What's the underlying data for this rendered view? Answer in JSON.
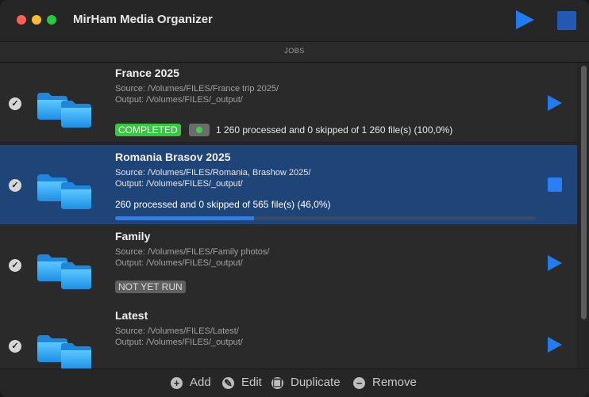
{
  "app": {
    "title": "MirHam Media Organizer"
  },
  "toolbar": {
    "play_icon": "play-icon",
    "stop_icon": "stop-icon"
  },
  "section": {
    "label": "JOBS"
  },
  "jobs": [
    {
      "name": "France 2025",
      "source": "Source: /Volumes/FILES/France trip 2025/",
      "output": "Output: /Volumes/FILES/_output/",
      "status": "COMPLETED",
      "progress_text": "1 260 processed and 0 skipped of 1 260 file(s) (100,0%)"
    },
    {
      "name": "Romania Brasov 2025",
      "source": "Source: /Volumes/FILES/Romania, Brashow 2025/",
      "output": "Output: /Volumes/FILES/_output/",
      "progress_text": "260 processed and 0 skipped of 565 file(s) (46,0%)",
      "progress_fraction": 0.33
    },
    {
      "name": "Family",
      "source": "Source: /Volumes/FILES/Family photos/",
      "output": "Output: /Volumes/FILES/_output/",
      "status": "NOT YET RUN"
    },
    {
      "name": "Latest",
      "source": "Source: /Volumes/FILES/Latest/",
      "output": "Output: /Volumes/FILES/_output/"
    }
  ],
  "footer": {
    "add_label": "Add",
    "edit_label": "Edit",
    "duplicate_label": "Duplicate",
    "remove_label": "Remove"
  },
  "colors": {
    "accent": "#1f7cf2",
    "selected_row": "#1f4478",
    "completed_badge": "#35c940"
  }
}
